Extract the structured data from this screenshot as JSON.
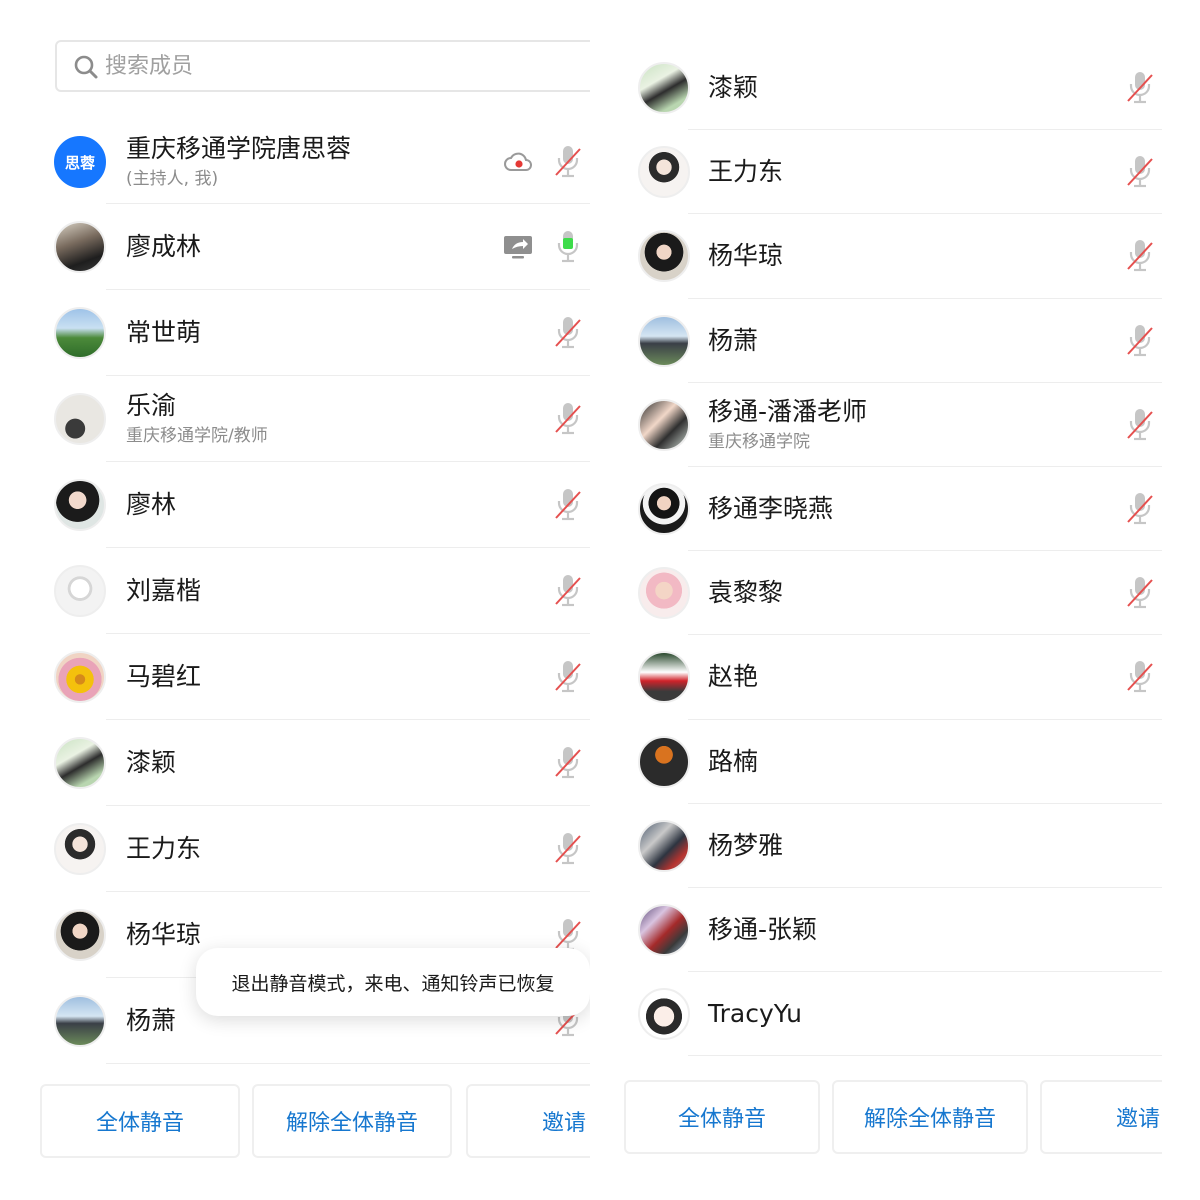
{
  "search": {
    "placeholder": "搜索成员"
  },
  "left_panel": {
    "members": [
      {
        "name": "重庆移通学院唐思蓉",
        "subtitle": "(主持人, 我)",
        "avatar_text": "思蓉",
        "avatar_style": "host",
        "mic": "muted",
        "status_icon": "cloud-record-icon"
      },
      {
        "name": "廖成林",
        "subtitle": "",
        "avatar_style": "photo-man-dark",
        "mic": "active",
        "status_icon": "screen-share-icon"
      },
      {
        "name": "常世萌",
        "subtitle": "",
        "avatar_style": "photo-landscape",
        "mic": "muted"
      },
      {
        "name": "乐渝",
        "subtitle": "重庆移通学院/教师",
        "avatar_style": "photo-light",
        "mic": "muted"
      },
      {
        "name": "廖林",
        "subtitle": "",
        "avatar_style": "photo-girl",
        "mic": "muted"
      },
      {
        "name": "刘嘉楷",
        "subtitle": "",
        "avatar_style": "photo-sketch",
        "mic": "muted"
      },
      {
        "name": "马碧红",
        "subtitle": "",
        "avatar_style": "photo-flower",
        "mic": "muted"
      },
      {
        "name": "漆颖",
        "subtitle": "",
        "avatar_style": "photo-couple",
        "mic": "muted"
      },
      {
        "name": "王力东",
        "subtitle": "",
        "avatar_style": "photo-drawing",
        "mic": "muted"
      },
      {
        "name": "杨华琼",
        "subtitle": "",
        "avatar_style": "photo-woman",
        "mic": "muted"
      },
      {
        "name": "杨萧",
        "subtitle": "",
        "avatar_style": "photo-car",
        "mic": "muted"
      }
    ],
    "buttons": {
      "mute_all": "全体静音",
      "unmute_all": "解除全体静音",
      "invite": "邀请"
    }
  },
  "right_panel": {
    "members": [
      {
        "name": "漆颖",
        "subtitle": "",
        "avatar_style": "photo-couple",
        "mic": "muted"
      },
      {
        "name": "王力东",
        "subtitle": "",
        "avatar_style": "photo-drawing",
        "mic": "muted"
      },
      {
        "name": "杨华琼",
        "subtitle": "",
        "avatar_style": "photo-woman",
        "mic": "muted"
      },
      {
        "name": "杨萧",
        "subtitle": "",
        "avatar_style": "photo-car",
        "mic": "muted"
      },
      {
        "name": "移通-潘潘老师",
        "subtitle": "重庆移通学院",
        "avatar_style": "photo-group",
        "mic": "muted"
      },
      {
        "name": "移通李晓燕",
        "subtitle": "",
        "avatar_style": "photo-woman-black",
        "mic": "muted"
      },
      {
        "name": "袁黎黎",
        "subtitle": "",
        "avatar_style": "photo-baby",
        "mic": "muted"
      },
      {
        "name": "赵艳",
        "subtitle": "",
        "avatar_style": "photo-racecar",
        "mic": "muted"
      },
      {
        "name": "路楠",
        "subtitle": "",
        "avatar_style": "photo-dark",
        "mic": "none"
      },
      {
        "name": "杨梦雅",
        "subtitle": "",
        "avatar_style": "photo-crowd",
        "mic": "none"
      },
      {
        "name": "移通-张颖",
        "subtitle": "",
        "avatar_style": "photo-crowd2",
        "mic": "none"
      },
      {
        "name": "TracyYu",
        "subtitle": "",
        "avatar_style": "photo-cartoon",
        "mic": "none"
      }
    ],
    "buttons": {
      "mute_all": "全体静音",
      "unmute_all": "解除全体静音",
      "invite": "邀请"
    }
  },
  "toast": {
    "message": "退出静音模式，来电、通知铃声已恢复"
  },
  "colors": {
    "accent": "#1677ff",
    "button_text": "#1677cf",
    "muted_slash": "#e5504f",
    "mic_active": "#3ddc4a",
    "mic_gray": "#c6c6c6"
  }
}
